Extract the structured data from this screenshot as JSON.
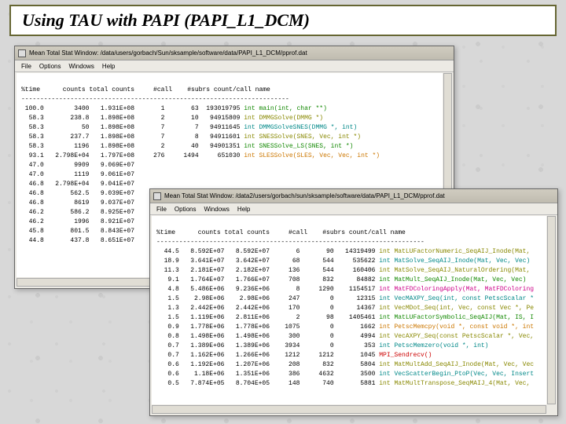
{
  "slide": {
    "title": "Using TAU with PAPI (PAPI_L1_DCM)"
  },
  "menu": {
    "file": "File",
    "options": "Options",
    "windows": "Windows",
    "help": "Help"
  },
  "header_line": "%time      counts total counts     #call    #subrs count/call name",
  "dashes": "-----------------------------------------------------------------------",
  "win1": {
    "title": "Mean Total Stat Window: /data/users/gorbach/Sun/sksample/software/data/PAPI_L1_DCM/pprof.dat",
    "rows": [
      {
        "t": "100.0",
        "c": "3400",
        "tc": "1.931E+08",
        "n": "1",
        "s": "63",
        "cc": "193019795",
        "fn": "int main(int, char **)",
        "col": "c-green"
      },
      {
        "t": "58.3",
        "c": "238.8",
        "tc": "1.898E+08",
        "n": "2",
        "s": "10",
        "cc": "94915809",
        "fn": "int DMMGSolve(DMMG *)",
        "col": "c-olive"
      },
      {
        "t": "58.3",
        "c": "50",
        "tc": "1.898E+08",
        "n": "7",
        "s": "7",
        "cc": "94911645",
        "fn": "int DMMGSolveSNES(DMMG *, int)",
        "col": "c-teal"
      },
      {
        "t": "58.3",
        "c": "237.7",
        "tc": "1.898E+08",
        "n": "7",
        "s": "8",
        "cc": "94911601",
        "fn": "int SNESSolve(SNES, Vec, int *)",
        "col": "c-olive"
      },
      {
        "t": "58.3",
        "c": "1196",
        "tc": "1.898E+08",
        "n": "2",
        "s": "40",
        "cc": "94901351",
        "fn": "int SNESSolve_LS(SNES, int *)",
        "col": "c-green"
      },
      {
        "t": "93.1",
        "c": "2.798E+04",
        "tc": "1.797E+08",
        "n": "276",
        "s": "1494",
        "cc": "651030",
        "fn": "int SLESSolve(SLES, Vec, Vec, int *)",
        "col": "c-orange"
      },
      {
        "t": "47.0",
        "c": "9909",
        "tc": "9.069E+07",
        "n": "",
        "s": "",
        "cc": "",
        "fn": "",
        "col": ""
      },
      {
        "t": "47.0",
        "c": "1119",
        "tc": "9.061E+07",
        "n": "",
        "s": "",
        "cc": "",
        "fn": "",
        "col": ""
      },
      {
        "t": "46.8",
        "c": "2.798E+04",
        "tc": "9.041E+07",
        "n": "",
        "s": "",
        "cc": "",
        "fn": "",
        "col": ""
      },
      {
        "t": "46.8",
        "c": "562.5",
        "tc": "9.039E+07",
        "n": "",
        "s": "",
        "cc": "",
        "fn": "",
        "col": ""
      },
      {
        "t": "46.8",
        "c": "8619",
        "tc": "9.037E+07",
        "n": "",
        "s": "",
        "cc": "",
        "fn": "",
        "col": ""
      },
      {
        "t": "46.2",
        "c": "586.2",
        "tc": "8.925E+07",
        "n": "",
        "s": "",
        "cc": "",
        "fn": "",
        "col": ""
      },
      {
        "t": "46.2",
        "c": "1996",
        "tc": "8.921E+07",
        "n": "",
        "s": "",
        "cc": "",
        "fn": "",
        "col": ""
      },
      {
        "t": "45.8",
        "c": "801.5",
        "tc": "8.843E+07",
        "n": "",
        "s": "",
        "cc": "",
        "fn": "",
        "col": ""
      },
      {
        "t": "44.8",
        "c": "437.8",
        "tc": "8.651E+07",
        "n": "",
        "s": "",
        "cc": "",
        "fn": "",
        "col": ""
      }
    ]
  },
  "win2": {
    "title": "Mean Total Stat Window: /data2/users/gorbach/sun/sksample/software/data/PAPI_L1_DCM/pprof.dat",
    "rows": [
      {
        "t": "44.5",
        "c": "8.592E+07",
        "tc": "8.592E+07",
        "n": "6",
        "s": "90",
        "cc": "14319499",
        "fn": "int MatLUFactorNumeric_SeqAIJ_Inode(Mat,",
        "col": "c-olive"
      },
      {
        "t": "18.9",
        "c": "3.641E+07",
        "tc": "3.642E+07",
        "n": "68",
        "s": "544",
        "cc": "535622",
        "fn": "int MatSolve_SeqAIJ_Inode(Mat, Vec, Vec)",
        "col": "c-teal"
      },
      {
        "t": "11.3",
        "c": "2.181E+07",
        "tc": "2.182E+07",
        "n": "136",
        "s": "544",
        "cc": "160406",
        "fn": "int MatSolve_SeqAIJ_NaturalOrdering(Mat,",
        "col": "c-olive"
      },
      {
        "t": "9.1",
        "c": "1.764E+07",
        "tc": "1.766E+07",
        "n": "708",
        "s": "832",
        "cc": "84882",
        "fn": "int MatMult_SeqAIJ_Inode(Mat, Vec, Vec)",
        "col": "c-green"
      },
      {
        "t": "4.8",
        "c": "5.486E+06",
        "tc": "9.236E+06",
        "n": "8",
        "s": "1290",
        "cc": "1154517",
        "fn": "int MatFDColoringApply(Mat, MatFDColoring",
        "col": "c-pink"
      },
      {
        "t": "1.5",
        "c": "2.98E+06",
        "tc": "2.98E+06",
        "n": "247",
        "s": "0",
        "cc": "12315",
        "fn": "int VecMAXPY_Seq(int, const PetscScalar *",
        "col": "c-teal"
      },
      {
        "t": "1.3",
        "c": "2.442E+06",
        "tc": "2.442E+06",
        "n": "170",
        "s": "0",
        "cc": "14367",
        "fn": "int VecMDot_Seq(int, Vec, const Vec *, Pe",
        "col": "c-olive"
      },
      {
        "t": "1.5",
        "c": "1.119E+06",
        "tc": "2.811E+06",
        "n": "2",
        "s": "98",
        "cc": "1405461",
        "fn": "int MatLUFactorSymbolic_SeqAIJ(Mat, IS, I",
        "col": "c-green"
      },
      {
        "t": "0.9",
        "c": "1.778E+06",
        "tc": "1.778E+06",
        "n": "1075",
        "s": "0",
        "cc": "1662",
        "fn": "int PetscMemcpy(void *, const void *, int",
        "col": "c-orange"
      },
      {
        "t": "0.8",
        "c": "1.498E+06",
        "tc": "1.498E+06",
        "n": "300",
        "s": "0",
        "cc": "4994",
        "fn": "int VecAXPY_Seq(const PetscScalar *, Vec,",
        "col": "c-olive"
      },
      {
        "t": "0.7",
        "c": "1.389E+06",
        "tc": "1.389E+06",
        "n": "3934",
        "s": "0",
        "cc": "353",
        "fn": "int PetscMemzero(void *, int)",
        "col": "c-teal"
      },
      {
        "t": "0.7",
        "c": "1.162E+06",
        "tc": "1.266E+06",
        "n": "1212",
        "s": "1212",
        "cc": "1045",
        "fn": "MPI_Sendrecv()",
        "col": "c-red"
      },
      {
        "t": "0.6",
        "c": "1.192E+06",
        "tc": "1.207E+06",
        "n": "208",
        "s": "832",
        "cc": "5804",
        "fn": "int MatMultAdd_SeqAIJ_Inode(Mat, Vec, Vec",
        "col": "c-olive"
      },
      {
        "t": "0.6",
        "c": "1.18E+06",
        "tc": "1.351E+06",
        "n": "386",
        "s": "4632",
        "cc": "3500",
        "fn": "int VecScatterBegin_PtoP(Vec, Vec, Insert",
        "col": "c-teal"
      },
      {
        "t": "0.5",
        "c": "7.874E+05",
        "tc": "8.704E+05",
        "n": "148",
        "s": "740",
        "cc": "5881",
        "fn": "int MatMultTranspose_SeqMAIJ_4(Mat, Vec,",
        "col": "c-olive"
      }
    ]
  }
}
